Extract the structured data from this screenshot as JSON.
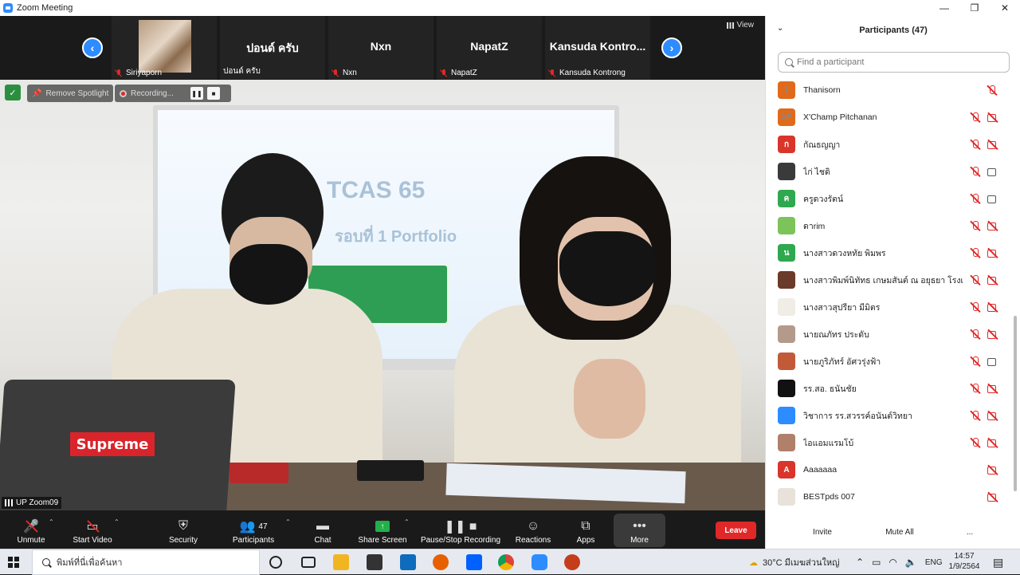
{
  "window": {
    "title": "Zoom Meeting",
    "controls": [
      "—",
      "❐",
      "✕"
    ]
  },
  "thumbnails": [
    {
      "label": "Siriyaporn",
      "center": "",
      "has_photo": true
    },
    {
      "label": "ปอนด์ ครับ",
      "center": "ปอนด์ ครับ",
      "has_photo": false
    },
    {
      "label": "Nxn",
      "center": "Nxn",
      "has_photo": false
    },
    {
      "label": "NapatZ",
      "center": "NapatZ",
      "has_photo": false
    },
    {
      "label": "Kansuda Kontrong",
      "center": "Kansuda Kontro...",
      "has_photo": false
    }
  ],
  "view_label": "View",
  "overlay": {
    "remove_spotlight": "Remove Spotlight",
    "recording": "Recording..."
  },
  "speaker_label": "UP Zoom09",
  "video_props": {
    "laptop_sticker": "Supreme",
    "screen_text_1": "TCAS 65",
    "screen_text_2": "รอบที่ 1 Portfolio"
  },
  "toolbar": {
    "unmute": "Unmute",
    "start_video": "Start Video",
    "security": "Security",
    "participants": "Participants",
    "participants_count": "47",
    "chat": "Chat",
    "share_screen": "Share Screen",
    "pause_stop": "Pause/Stop Recording",
    "reactions": "Reactions",
    "apps": "Apps",
    "more": "More",
    "leave": "Leave"
  },
  "panel": {
    "title": "Participants (47)",
    "search_placeholder": "Find a participant",
    "participants": [
      {
        "initials": "T",
        "name": "Thanisorn",
        "color": "#e06a1b",
        "cam": "none"
      },
      {
        "initials": "XP",
        "name": "X'Champ Pitchanan",
        "color": "#e06a1b",
        "cam": "off"
      },
      {
        "initials": "ก",
        "name": "กัณธญญา",
        "color": "#d9352b",
        "cam": "off"
      },
      {
        "initials": "",
        "name": "ไก่ ไชดิ",
        "color": "#3a3a3a",
        "cam": "on"
      },
      {
        "initials": "ค",
        "name": "ครูดวงรัตน์",
        "color": "#2fa84f",
        "cam": "on"
      },
      {
        "initials": "",
        "name": "ดาrim",
        "color": "#7cc35a",
        "cam": "off"
      },
      {
        "initials": "น",
        "name": "นางสาวดวงหทัย พิมพร",
        "color": "#2fa84f",
        "cam": "off"
      },
      {
        "initials": "",
        "name": "นางสาวพิมพ์นิทัทธ เกษมสันต์ ณ อยุธยา โรงเรียนสา...",
        "color": "#6b3a2a",
        "cam": "off"
      },
      {
        "initials": "",
        "name": "นางสาวสุปรียา มีมิตร",
        "color": "#f0ece6",
        "cam": "off"
      },
      {
        "initials": "",
        "name": "นายณภัทร ประดับ",
        "color": "#b49a8a",
        "cam": "off"
      },
      {
        "initials": "",
        "name": "นายภูริภัทร์ อัศวรุ่งฟ้า",
        "color": "#c25a3a",
        "cam": "on"
      },
      {
        "initials": "",
        "name": "รร.สอ. ธนันชัย",
        "color": "#111111",
        "cam": "off"
      },
      {
        "initials": "",
        "name": "วิชาการ รร.สวรรค์อนันต์วิทยา",
        "color": "#2d8cff",
        "cam": "off"
      },
      {
        "initials": "",
        "name": "ไอแอมแรมโบ้",
        "color": "#b0806a",
        "cam": "off"
      },
      {
        "initials": "A",
        "name": "Aaaaaaa",
        "color": "#d9352b",
        "cam": "off",
        "no_mic": true
      },
      {
        "initials": "",
        "name": "BESTpds 007",
        "color": "#e8e2da",
        "cam": "off",
        "no_mic": true
      }
    ],
    "footer": {
      "invite": "Invite",
      "mute_all": "Mute All",
      "more": "..."
    }
  },
  "taskbar": {
    "search_placeholder": "พิมพ์ที่นี่เพื่อค้นหา",
    "weather": "30°C  มีเมฆส่วนใหญ่",
    "lang": "ENG",
    "time": "14:57",
    "date": "1/9/2564"
  }
}
